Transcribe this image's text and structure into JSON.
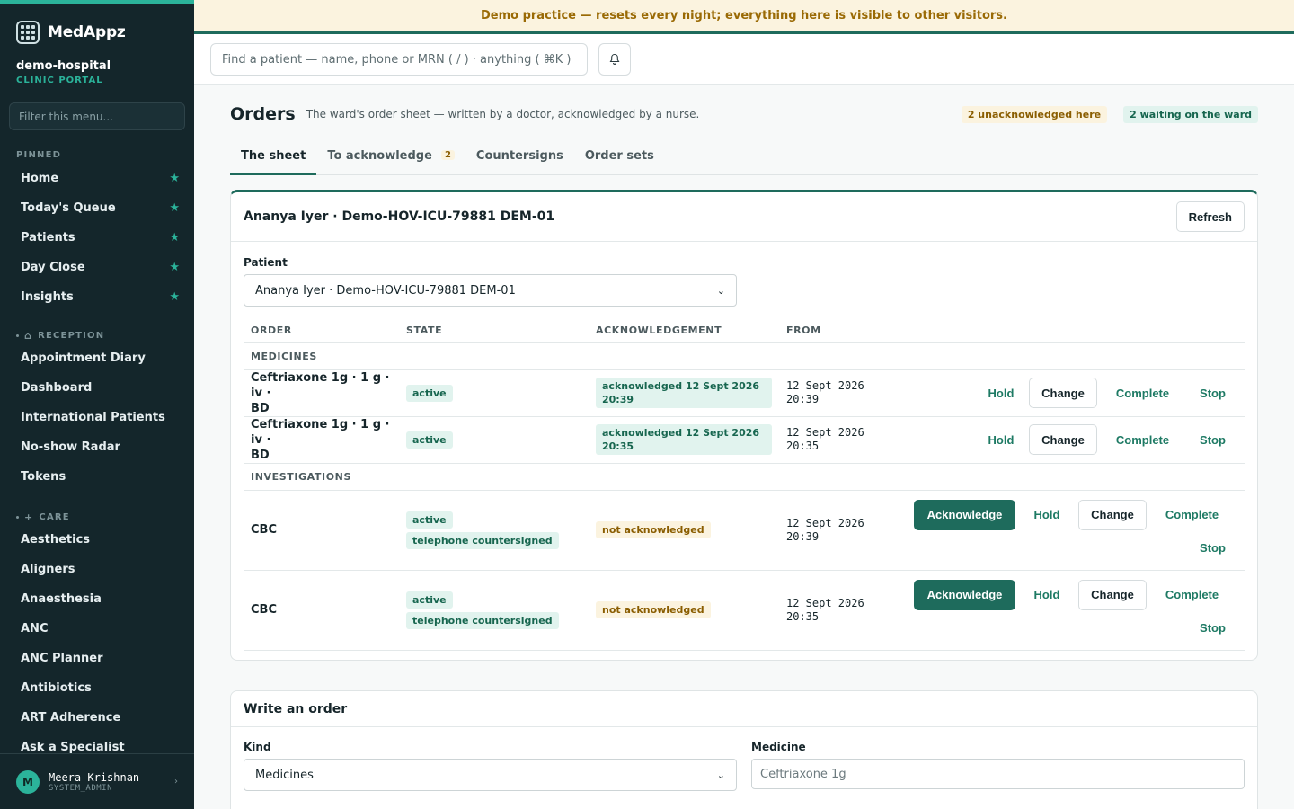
{
  "app": {
    "name": "MedAppz",
    "org": "demo-hospital",
    "portal": "CLINIC PORTAL"
  },
  "sidebar": {
    "filter_placeholder": "Filter this menu...",
    "pinned_label": "PINNED",
    "pinned": [
      {
        "label": "Home"
      },
      {
        "label": "Today's Queue"
      },
      {
        "label": "Patients"
      },
      {
        "label": "Day Close"
      },
      {
        "label": "Insights"
      }
    ],
    "reception_label": "RECEPTION",
    "reception": [
      {
        "label": "Appointment Diary"
      },
      {
        "label": "Dashboard"
      },
      {
        "label": "International Patients"
      },
      {
        "label": "No-show Radar"
      },
      {
        "label": "Tokens"
      }
    ],
    "care_label": "CARE",
    "care": [
      {
        "label": "Aesthetics"
      },
      {
        "label": "Aligners"
      },
      {
        "label": "Anaesthesia"
      },
      {
        "label": "ANC"
      },
      {
        "label": "ANC Planner"
      },
      {
        "label": "Antibiotics"
      },
      {
        "label": "ART Adherence"
      },
      {
        "label": "Ask a Specialist"
      }
    ],
    "user": {
      "initial": "M",
      "name": "Meera Krishnan",
      "role": "SYSTEM_ADMIN"
    }
  },
  "banner": {
    "text": "Demo practice — resets every night; everything here is visible to other visitors."
  },
  "search": {
    "placeholder": "Find a patient — name, phone or MRN ( / ) · anything ( ⌘K )"
  },
  "page": {
    "title": "Orders",
    "description": "The ward's order sheet — written by a doctor, acknowledged by a nurse.",
    "badge_unack": "2 unacknowledged here",
    "badge_waiting": "2 waiting on the ward"
  },
  "tabs": [
    {
      "label": "The sheet"
    },
    {
      "label": "To acknowledge",
      "count": "2"
    },
    {
      "label": "Countersigns"
    },
    {
      "label": "Order sets"
    }
  ],
  "sheet": {
    "title": "Ananya Iyer · Demo-HOV-ICU-79881 DEM-01",
    "refresh": "Refresh",
    "patient_label": "Patient",
    "patient_value": "Ananya Iyer · Demo-HOV-ICU-79881 DEM-01",
    "columns": [
      "ORDER",
      "STATE",
      "ACKNOWLEDGEMENT",
      "FROM"
    ],
    "groups": {
      "medicines": "MEDICINES",
      "investigations": "INVESTIGATIONS"
    },
    "medicine_rows": [
      {
        "order_line1": "Ceftriaxone 1g · 1 g · iv ·",
        "order_line2": "BD",
        "state": "active",
        "ack": "acknowledged 12 Sept 2026 20:39",
        "from_date": "12 Sept 2026",
        "from_time": "20:39"
      },
      {
        "order_line1": "Ceftriaxone 1g · 1 g · iv ·",
        "order_line2": "BD",
        "state": "active",
        "ack": "acknowledged 12 Sept 2026 20:35",
        "from_date": "12 Sept 2026",
        "from_time": "20:35"
      }
    ],
    "investigation_rows": [
      {
        "order": "CBC",
        "state": "active",
        "state2": "telephone countersigned",
        "ack": "not acknowledged",
        "from_date": "12 Sept 2026",
        "from_time": "20:39"
      },
      {
        "order": "CBC",
        "state": "active",
        "state2": "telephone countersigned",
        "ack": "not acknowledged",
        "from_date": "12 Sept 2026",
        "from_time": "20:35"
      }
    ],
    "actions": {
      "acknowledge": "Acknowledge",
      "hold": "Hold",
      "change": "Change",
      "complete": "Complete",
      "stop": "Stop"
    }
  },
  "write": {
    "title": "Write an order",
    "kind_label": "Kind",
    "kind_value": "Medicines",
    "medicine_label": "Medicine",
    "medicine_placeholder": "Ceftriaxone 1g"
  },
  "colors": {
    "accent": "#1e6b5c",
    "sidebar": "#14262b",
    "brand_green": "#2bb39a",
    "warn_bg": "#fbf3df"
  }
}
